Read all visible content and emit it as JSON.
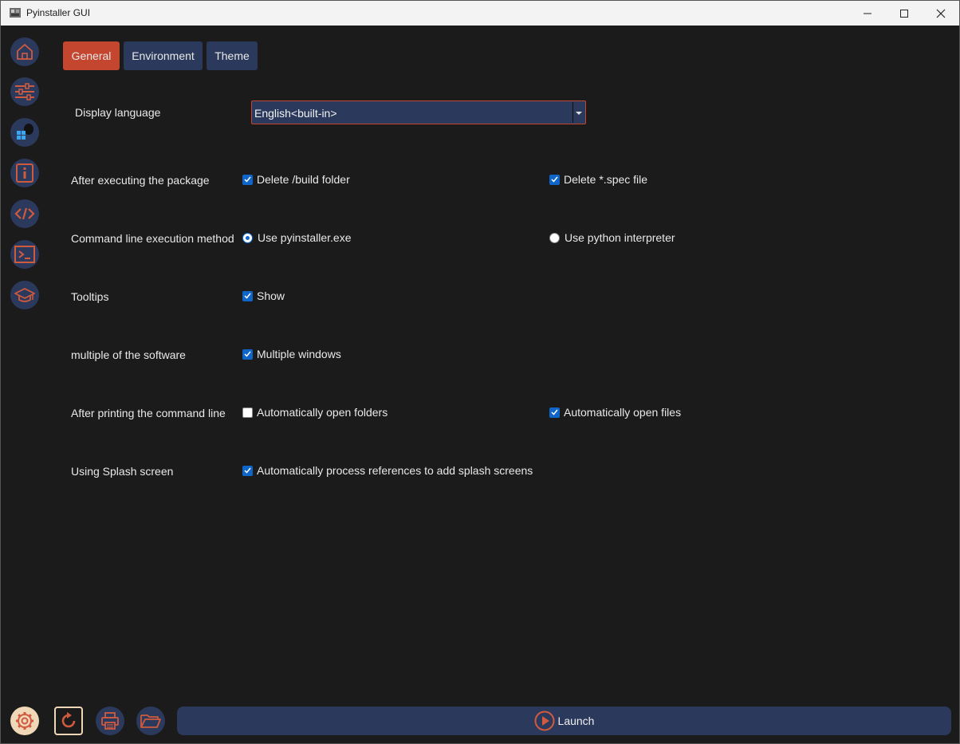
{
  "window": {
    "title": "Pyinstaller GUI"
  },
  "sidebar": {
    "items": [
      {
        "icon": "home-icon"
      },
      {
        "icon": "sliders-icon"
      },
      {
        "icon": "platform-icon"
      },
      {
        "icon": "info-icon"
      },
      {
        "icon": "code-icon"
      },
      {
        "icon": "terminal-icon"
      },
      {
        "icon": "graduation-cap-icon"
      }
    ]
  },
  "tabs": [
    {
      "label": "General",
      "active": true
    },
    {
      "label": "Environment",
      "active": false
    },
    {
      "label": "Theme",
      "active": false
    }
  ],
  "settings": {
    "display_language": {
      "label": "Display language",
      "value": "English<built-in>"
    },
    "after_execute": {
      "label": "After executing the package",
      "opt1": "Delete /build folder",
      "opt1_checked": true,
      "opt2": "Delete *.spec file",
      "opt2_checked": true
    },
    "exec_method": {
      "label": "Command line execution method",
      "opt1": "Use pyinstaller.exe",
      "opt1_selected": true,
      "opt2": "Use python interpreter",
      "opt2_selected": false
    },
    "tooltips": {
      "label": "Tooltips",
      "opt1": "Show",
      "opt1_checked": true
    },
    "multiple": {
      "label": "multiple of the software",
      "opt1": "Multiple windows",
      "opt1_checked": true
    },
    "after_print": {
      "label": "After printing the command line",
      "opt1": "Automatically open folders",
      "opt1_checked": false,
      "opt2": "Automatically open files",
      "opt2_checked": true
    },
    "splash": {
      "label": "Using Splash screen",
      "opt1": "Automatically process references to add splash screens",
      "opt1_checked": true
    }
  },
  "bottom": {
    "launch_label": "Launch"
  },
  "colors": {
    "accent": "#c4462f",
    "panel": "#2b3a5c",
    "background": "#1b1b1b",
    "check": "#0f66c8"
  }
}
